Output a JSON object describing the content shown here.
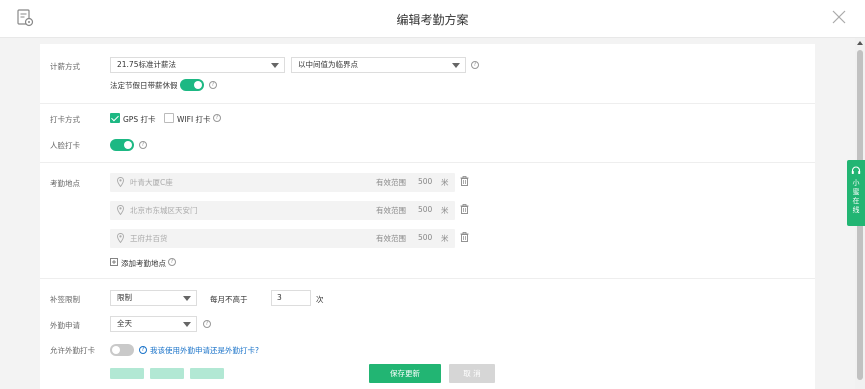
{
  "header": {
    "title": "编辑考勤方案"
  },
  "salary": {
    "label": "计薪方式",
    "method_value": "21.75标准计薪法",
    "boundary_value": "以中间值为临界点",
    "holiday_label": "法定节假日带薪休假",
    "holiday_on": true
  },
  "clock": {
    "label": "打卡方式",
    "gps_label": "GPS 打卡",
    "gps_checked": true,
    "wifi_label": "WIFI 打卡",
    "wifi_checked": false
  },
  "face": {
    "label": "人脸打卡",
    "on": true
  },
  "locations": {
    "label": "考勤地点",
    "range_label": "有效范围",
    "unit": "米",
    "items": [
      {
        "name": "叶青大厦C座",
        "range": "500"
      },
      {
        "name": "北京市东城区天安门",
        "range": "500"
      },
      {
        "name": "王府井百货",
        "range": "500"
      }
    ],
    "add_label": "添加考勤地点"
  },
  "supplement": {
    "label": "补签限制",
    "value": "限制",
    "monthly_label": "每月不高于",
    "count": "3",
    "count_unit": "次"
  },
  "outing": {
    "label": "外勤申请",
    "value": "全天"
  },
  "allow_outing": {
    "label": "允许外勤打卡",
    "on": false,
    "help_link": "我该使用外勤申请还是外勤打卡?"
  },
  "footer": {
    "save_label": "保存更新",
    "cancel_label": "取 消"
  },
  "side_tab": {
    "label": "小蜜在线"
  },
  "colors": {
    "accent": "#22b573",
    "link": "#1a73c9"
  }
}
